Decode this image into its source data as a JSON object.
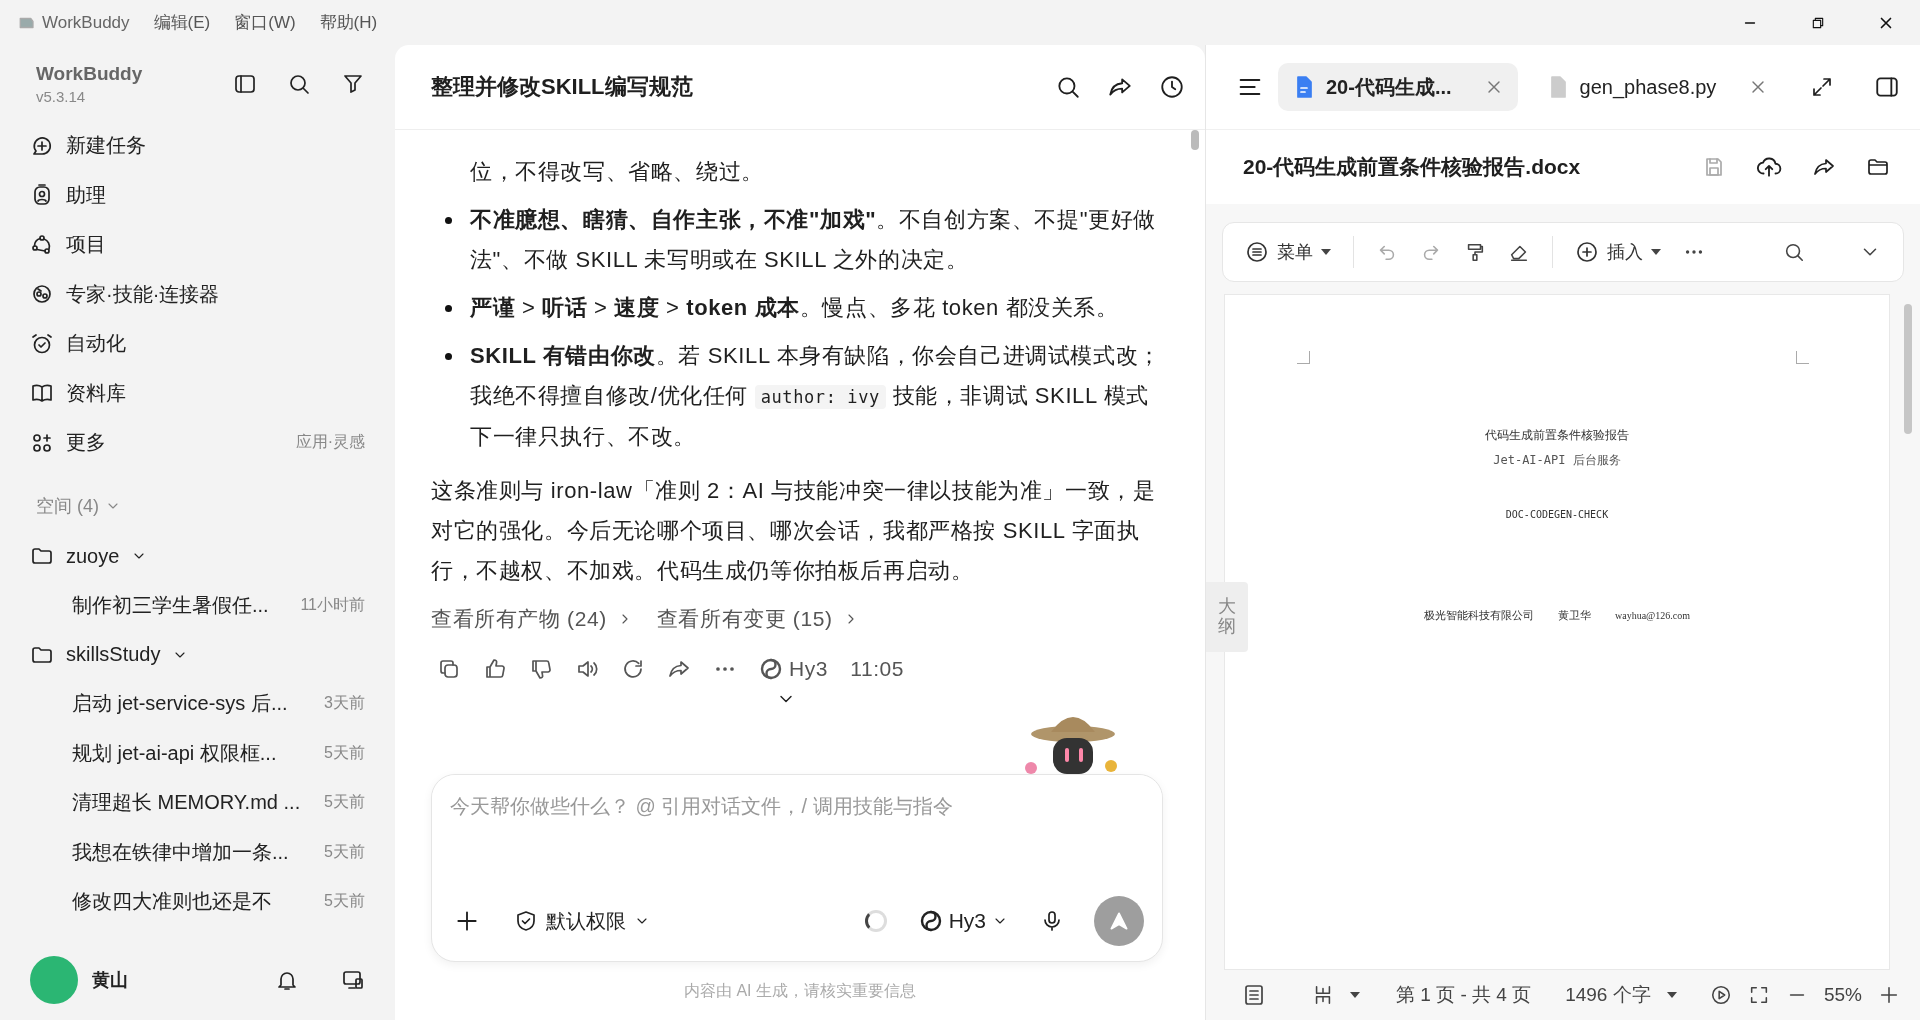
{
  "menu_bar": {
    "app": "WorkBuddy",
    "items": [
      "编辑(E)",
      "窗口(W)",
      "帮助(H)"
    ]
  },
  "sidebar": {
    "app_name": "WorkBuddy",
    "version": "v5.3.14",
    "nav": [
      {
        "kind": "new",
        "label": "新建任务"
      },
      {
        "kind": "assistant",
        "label": "助理"
      },
      {
        "kind": "project",
        "label": "项目"
      },
      {
        "kind": "experts",
        "label": "专家·技能·连接器"
      },
      {
        "kind": "automation",
        "label": "自动化"
      },
      {
        "kind": "library",
        "label": "资料库"
      },
      {
        "kind": "more",
        "label": "更多",
        "hint": "应用·灵感"
      }
    ],
    "spaces": {
      "title": "空间 (4)",
      "groups": [
        {
          "name": "zuoye",
          "expanded": true,
          "tasks": [
            {
              "title": "制作初三学生暑假任...",
              "time": "11小时前"
            }
          ]
        },
        {
          "name": "skillsStudy",
          "expanded": true,
          "tasks": [
            {
              "title": "启动 jet-service-sys 后...",
              "time": "3天前"
            },
            {
              "title": "规划 jet-ai-api 权限框...",
              "time": "5天前"
            },
            {
              "title": "清理超长 MEMORY.md ...",
              "time": "5天前"
            },
            {
              "title": "我想在铁律中增加一条...",
              "time": "5天前"
            },
            {
              "title": "修改四大准则也还是不",
              "time": "5天前"
            }
          ]
        }
      ]
    },
    "user": {
      "name": "黄山"
    }
  },
  "chat": {
    "title": "整理并修改SKILL编写规范",
    "blocks": [
      {
        "kind": "continuation",
        "parts": [
          {
            "kind": "text",
            "text": "位，不得改写、省略、绕过。"
          }
        ]
      },
      {
        "kind": "bullet",
        "parts": [
          {
            "kind": "text",
            "text": "**不准臆想、瞎猜、自作主张，不准\"加戏\"**。不自创方案、不提\"更好做法\"、不做 SKILL 未写明或在 SKILL 之外的决定。"
          }
        ]
      },
      {
        "kind": "bullet",
        "parts": [
          {
            "kind": "text",
            "text": "**严谨** > **听话** > **速度** > **token 成本**。慢点、多花 token 都没关系。"
          }
        ]
      },
      {
        "kind": "bullet",
        "parts": [
          {
            "kind": "text",
            "text": "**SKILL 有错由你改**。若 SKILL 本身有缺陷，你会自己进调试模式改；我绝不得擅自修改/优化任何 "
          },
          {
            "kind": "code",
            "text": "author: ivy"
          },
          {
            "kind": "text",
            "text": " 技能，非调试 SKILL 模式下一律只执行、不改。"
          }
        ]
      },
      {
        "kind": "paragraph",
        "parts": [
          {
            "kind": "text",
            "text": "这条准则与 iron-law「准则 2：AI 与技能冲突一律以技能为准」一致，是对它的强化。今后无论哪个项目、哪次会话，我都严格按 SKILL 字面执行，不越权、不加戏。代码生成仍等你拍板后再启动。"
          }
        ]
      }
    ],
    "links": [
      "查看所有产物 (24)",
      "查看所有变更 (15)"
    ],
    "meta": {
      "model": "Hy3",
      "time": "11:05"
    },
    "composer": {
      "placeholder": "今天帮你做些什么？ @ 引用对话文件，/ 调用技能与指令",
      "permission": "默认权限",
      "model": "Hy3"
    },
    "disclaimer": "内容由 AI 生成，请核实重要信息"
  },
  "doc_panel": {
    "tabs": [
      {
        "kind": "docx",
        "label": "20-代码生成...",
        "selected": true
      },
      {
        "kind": "file",
        "label": "gen_phase8.py",
        "selected": false
      }
    ],
    "file_name": "20-代码生成前置条件核验报告.docx",
    "toolbar": {
      "menu": "菜单",
      "insert": "插入"
    },
    "outline_tab": "大纲",
    "page": {
      "title": "代码生成前置条件核验报告",
      "subtitle": "Jet-AI-API 后台服务",
      "code": "DOC-CODEGEN-CHECK",
      "company": "极光智能科技有限公司",
      "author": "黄卫华",
      "email": "wayhua@126.com"
    },
    "status": {
      "page": "第 1 页 - 共 4 页",
      "words": "1496 个字",
      "zoom": "55%"
    }
  }
}
